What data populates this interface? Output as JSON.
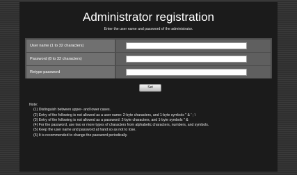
{
  "header": {
    "title": "Administrator registration",
    "subtitle": "Enter the user name and password of the administrator."
  },
  "form": {
    "fields": [
      {
        "label": "User name (1 to 32 characters)",
        "value": "",
        "placeholder": ""
      },
      {
        "label": "Password (8 to 32 characters)",
        "value": "",
        "placeholder": ""
      },
      {
        "label": "Retype password",
        "value": "",
        "placeholder": ""
      }
    ],
    "set_label": "Set"
  },
  "notes": {
    "title": "Note:",
    "items": [
      "(1) Distinguish between upper- and lower cases.",
      "(2) Entry of the following is not allowed as a user name:   2-byte characters, and 1-byte symbols \" & ' ; \\",
      "(3) Entry of the following is not allowed as a password:   2-byte characters, and 1-byte symbols \" &",
      "(4) For the password, use two or more types of characters from alphabetic characters, numbers, and symbols.",
      "(5) Keep the user name and password at hand so as not to lose.",
      "(6) It is recommended to change the password periodically."
    ]
  },
  "colors": {
    "background": "#333333",
    "panel": "#1b1b1b",
    "label_cell": "#707070",
    "input_cell": "#5f5f5f"
  }
}
